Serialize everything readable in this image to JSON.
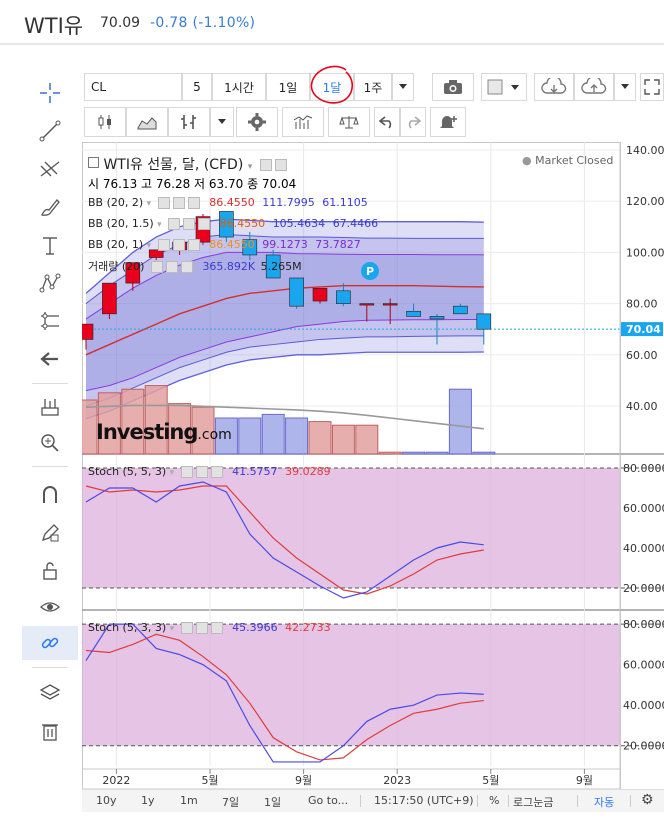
{
  "header": {
    "title": "WTI유",
    "price": "70.09",
    "change": "-0.78 (-1.10%)"
  },
  "toolbar": {
    "symbol": "CL",
    "interval_5": "5",
    "interval_1h": "1시간",
    "interval_1d": "1일",
    "interval_1m": "1달",
    "interval_1w": "1주"
  },
  "legend": {
    "main_title": "WTI유 선물, 달, (CFD)",
    "ohlc": "시 76.13  고 76.28  저 63.70  종 70.04",
    "market_status": "Market Closed",
    "bb1_label": "BB (20, 2)",
    "bb1_v1": "86.4550",
    "bb1_v2": "111.7995",
    "bb1_v3": "61.1105",
    "bb2_label": "BB (20, 1.5)",
    "bb2_v1": "86.4550",
    "bb2_v2": "105.4634",
    "bb2_v3": "67.4466",
    "bb3_label": "BB (20, 1)",
    "bb3_v1": "86.4550",
    "bb3_v2": "99.1273",
    "bb3_v3": "73.7827",
    "vol_label": "거래량 (20)",
    "vol_v1": "365.892K",
    "vol_v2": "5.265M",
    "stoch1_label": "Stoch (5, 5, 3)",
    "stoch1_k": "41.5757",
    "stoch1_d": "39.0289",
    "stoch2_label": "Stoch (5, 3, 3)",
    "stoch2_k": "45.3966",
    "stoch2_d": "42.2733",
    "logo_text": "Investing",
    "logo_suffix": ".com",
    "p_badge": "P"
  },
  "price_axis": {
    "ticks": [
      "140.00",
      "120.00",
      "100.00",
      "80.00",
      "60.00",
      "40.00"
    ],
    "last_price": "70.04"
  },
  "stoch_axis": {
    "ticks": [
      "80.0000",
      "60.0000",
      "40.0000",
      "20.0000"
    ]
  },
  "time_axis": {
    "labels": [
      "2022",
      "5월",
      "9월",
      "2023",
      "5월",
      "9월"
    ]
  },
  "bottom_bar": {
    "r10y": "10y",
    "r1y": "1y",
    "r1m": "1m",
    "r7d": "7일",
    "r1d": "1일",
    "goto": "Go to...",
    "time": "15:17:50 (UTC+9)",
    "pct": "%",
    "log": "로그눈금",
    "auto": "자동"
  },
  "colors": {
    "up": "#e8001c",
    "down": "#1aa6ee",
    "bb_band": "#6060d8",
    "basis": "#d32f2f",
    "stoch_bg": "#dcb0dc",
    "stoch_k": "#4a4ae8",
    "stoch_d": "#e03c3c",
    "link_active": "#2e7cf6"
  },
  "chart_data": {
    "type": "candlestick",
    "periods": [
      "2021-12",
      "2022-01",
      "2022-02",
      "2022-03",
      "2022-04",
      "2022-05",
      "2022-06",
      "2022-07",
      "2022-08",
      "2022-09",
      "2022-10",
      "2022-11",
      "2022-12",
      "2023-01",
      "2023-02",
      "2023-03",
      "2023-04",
      "2023-05"
    ],
    "candles": [
      {
        "o": 66,
        "h": 72,
        "l": 62,
        "c": 72
      },
      {
        "o": 76,
        "h": 88,
        "l": 74,
        "c": 88
      },
      {
        "o": 88,
        "h": 96,
        "l": 85,
        "c": 96
      },
      {
        "o": 98,
        "h": 100,
        "l": 97,
        "c": 101
      },
      {
        "o": 101,
        "h": 104,
        "l": 99,
        "c": 104
      },
      {
        "o": 104,
        "h": 115,
        "l": 103,
        "c": 114
      },
      {
        "o": 116,
        "h": 116,
        "l": 104,
        "c": 106
      },
      {
        "o": 105,
        "h": 108,
        "l": 97,
        "c": 99
      },
      {
        "o": 99,
        "h": 101,
        "l": 90,
        "c": 90
      },
      {
        "o": 90,
        "h": 90,
        "l": 78,
        "c": 79
      },
      {
        "o": 81,
        "h": 86,
        "l": 80,
        "c": 86
      },
      {
        "o": 85,
        "h": 88,
        "l": 79,
        "c": 80
      },
      {
        "o": 80,
        "h": 80,
        "l": 73,
        "c": 80
      },
      {
        "o": 80,
        "h": 82,
        "l": 72,
        "c": 80
      },
      {
        "o": 77,
        "h": 80,
        "l": 75,
        "c": 75
      },
      {
        "o": 75,
        "h": 76,
        "l": 64,
        "c": 74
      },
      {
        "o": 79,
        "h": 80,
        "l": 77,
        "c": 76
      },
      {
        "o": 76,
        "h": 76,
        "l": 64,
        "c": 70
      }
    ],
    "volume": [
      30,
      34,
      36,
      38,
      28,
      26,
      20,
      20,
      22,
      20,
      18,
      16,
      16,
      1,
      1,
      1,
      36,
      1
    ],
    "volume_up": [
      true,
      true,
      true,
      true,
      true,
      true,
      false,
      false,
      false,
      false,
      true,
      true,
      true,
      true,
      false,
      false,
      false,
      false
    ],
    "volume_ma": [
      26,
      26.5,
      27,
      27,
      27,
      26.5,
      26,
      25.5,
      25,
      24.5,
      23.8,
      22.8,
      21.5,
      20,
      18.5,
      17,
      15.5,
      14
    ],
    "bb_basis": [
      60,
      64,
      68,
      72,
      76,
      79,
      82,
      84,
      85,
      86,
      86.5,
      87,
      87,
      87,
      87,
      86.8,
      86.6,
      86.5
    ],
    "bb_upper2": [
      84,
      92,
      100,
      106,
      110,
      112,
      113,
      112.5,
      112,
      112,
      112,
      112,
      112,
      112,
      112,
      112,
      112,
      111.8
    ],
    "bb_lower2": [
      35,
      38,
      42,
      46,
      50,
      53,
      56,
      58,
      59,
      60,
      60,
      60.5,
      61,
      61,
      61,
      61,
      61,
      61.1
    ],
    "bb_upper1_5": [
      80,
      87,
      93,
      99,
      103,
      106,
      107,
      106.5,
      106,
      106,
      106,
      105.8,
      105.6,
      105.6,
      105.5,
      105.5,
      105.5,
      105.5
    ],
    "bb_lower1_5": [
      40,
      43,
      47,
      51,
      55,
      58,
      61,
      63,
      64,
      65,
      66,
      66.5,
      67,
      67,
      67.2,
      67.3,
      67.4,
      67.4
    ],
    "bb_upper1": [
      74,
      80,
      86,
      91,
      95,
      98,
      100,
      100,
      100,
      99.5,
      99.4,
      99.3,
      99.2,
      99.2,
      99.2,
      99.1,
      99.1,
      99.1
    ],
    "bb_lower1": [
      46,
      48,
      51,
      55,
      59,
      62,
      65,
      67,
      69,
      71,
      72,
      73,
      73.5,
      73.6,
      73.7,
      73.7,
      73.8,
      73.8
    ],
    "stoch1_k": [
      63,
      70,
      70,
      63,
      71,
      73,
      68,
      47,
      35,
      28,
      21,
      15,
      18,
      26,
      34,
      40,
      43,
      41.6
    ],
    "stoch1_d": [
      71,
      68,
      69,
      68,
      69,
      71,
      71,
      58,
      45,
      35,
      27,
      19,
      17,
      21,
      27,
      34,
      37,
      39
    ],
    "stoch2_k": [
      62,
      80,
      80,
      68,
      65,
      60,
      52,
      30,
      12,
      12,
      12,
      20,
      32,
      38,
      40,
      45,
      46,
      45.4
    ],
    "stoch2_d": [
      67,
      66,
      70,
      75,
      72,
      64,
      55,
      41,
      24,
      17,
      13,
      14,
      23,
      30,
      36,
      38,
      41,
      42.3
    ],
    "price_range": [
      20,
      142
    ],
    "stoch_range": [
      10,
      85
    ],
    "log_scale": false,
    "grid": true
  }
}
